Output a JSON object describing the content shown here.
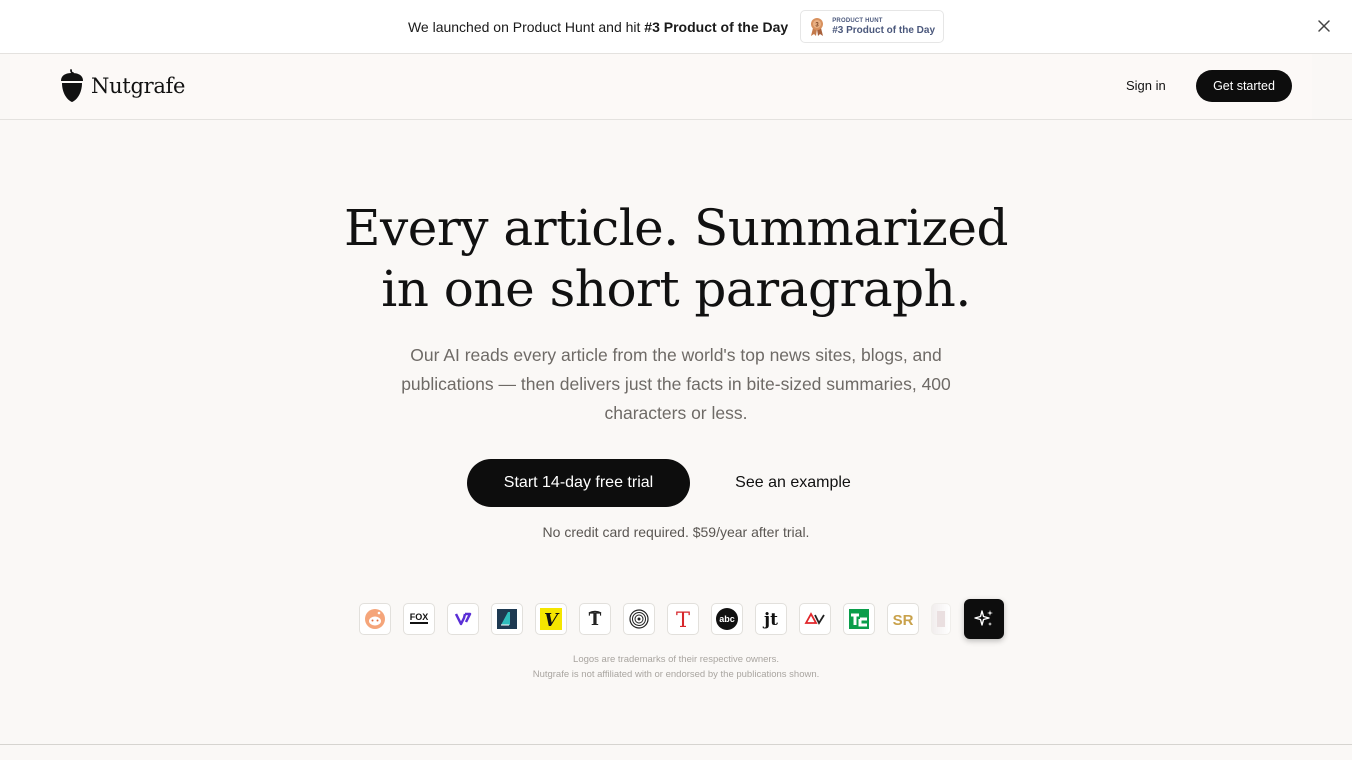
{
  "banner": {
    "text_prefix": "We launched on Product Hunt and hit ",
    "text_highlight": "#3 Product of the Day",
    "badge_small": "PRODUCT HUNT",
    "badge_big": "#3 Product of the Day"
  },
  "header": {
    "brand": "Nutgrafe",
    "signin_label": "Sign in",
    "getstarted_label": "Get started"
  },
  "hero": {
    "title_line1": "Every article. Summarized",
    "title_line2": "in one short paragraph.",
    "subtitle": "Our AI reads every article from the world's top news sites, blogs, and publications — then delivers just the facts in bite-sized summaries, 400 characters or less.",
    "primary_cta": "Start 14-day free trial",
    "secondary_cta": "See an example",
    "note": "No credit card required. $59/year after trial."
  },
  "publications": {
    "logos": [
      "reddit-logo",
      "fox-sports-logo",
      "verge-logo",
      "axios-logo",
      "vulture-logo",
      "nytimes-logo",
      "atlantic-logo",
      "tmag-logo",
      "abc-logo",
      "jt-logo",
      "av-club-logo",
      "techcrunch-logo",
      "sr-logo",
      "faded-logo"
    ],
    "fox_text": "FOX",
    "abc_text": "abc",
    "jt_text": "jt",
    "tmag_text": "T",
    "vulture_text": "V",
    "nyt_text": "T",
    "sr_text": "SR"
  },
  "disclaimer": {
    "line1": "Logos are trademarks of their respective owners.",
    "line2": "Nutgrafe is not affiliated with or endorsed by the publications shown."
  },
  "colors": {
    "background": "#faf8f6",
    "primary": "#0d0d0d",
    "muted_text": "#6e6a66",
    "product_hunt": "#4b587c"
  }
}
